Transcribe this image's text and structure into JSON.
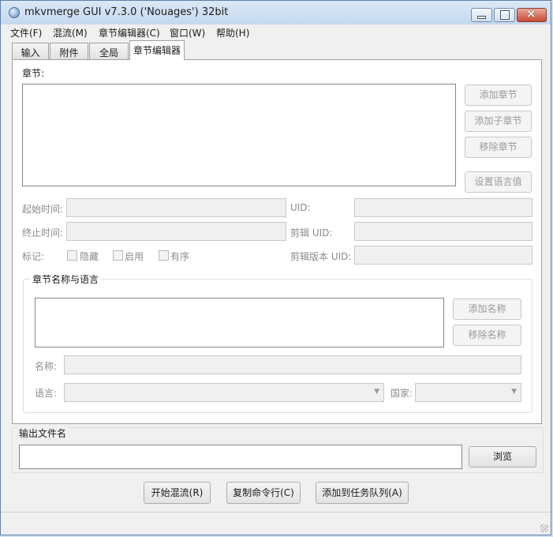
{
  "window": {
    "title": "mkvmerge GUI v7.3.0 ('Nouages') 32bit"
  },
  "menu": [
    {
      "label": "文件(F)"
    },
    {
      "label": "混流(M)"
    },
    {
      "label": "章节编辑器(C)"
    },
    {
      "label": "窗口(W)"
    },
    {
      "label": "帮助(H)"
    }
  ],
  "tabs": [
    {
      "label": "输入"
    },
    {
      "label": "附件"
    },
    {
      "label": "全局"
    },
    {
      "label": "章节编辑器"
    }
  ],
  "chapters": {
    "label": "章节:",
    "buttons": {
      "add_chapter": "添加章节",
      "add_sub_chapter": "添加子章节",
      "remove_chapter": "移除章节",
      "set_language": "设置语言值"
    },
    "fields": {
      "start_time": "起始时间:",
      "end_time": "终止时间:",
      "flags": "标记:",
      "uid": "UID:",
      "edit_uid": "剪辑 UID:",
      "edit_version_uid": "剪辑版本 UID:"
    },
    "checkboxes": {
      "hidden": "隐藏",
      "enabled": "启用",
      "ordered": "有序"
    }
  },
  "names_group": {
    "title": "章节名称与语言",
    "add_name": "添加名称",
    "remove_name": "移除名称",
    "name_label": "名称:",
    "language_label": "语言:",
    "country_label": "国家:"
  },
  "output": {
    "title": "输出文件名",
    "value": "",
    "browse": "浏览"
  },
  "actions": {
    "start_mux": "开始混流(R)",
    "copy_cmd": "复制命令行(C)",
    "add_queue": "添加到任务队列(A)"
  }
}
